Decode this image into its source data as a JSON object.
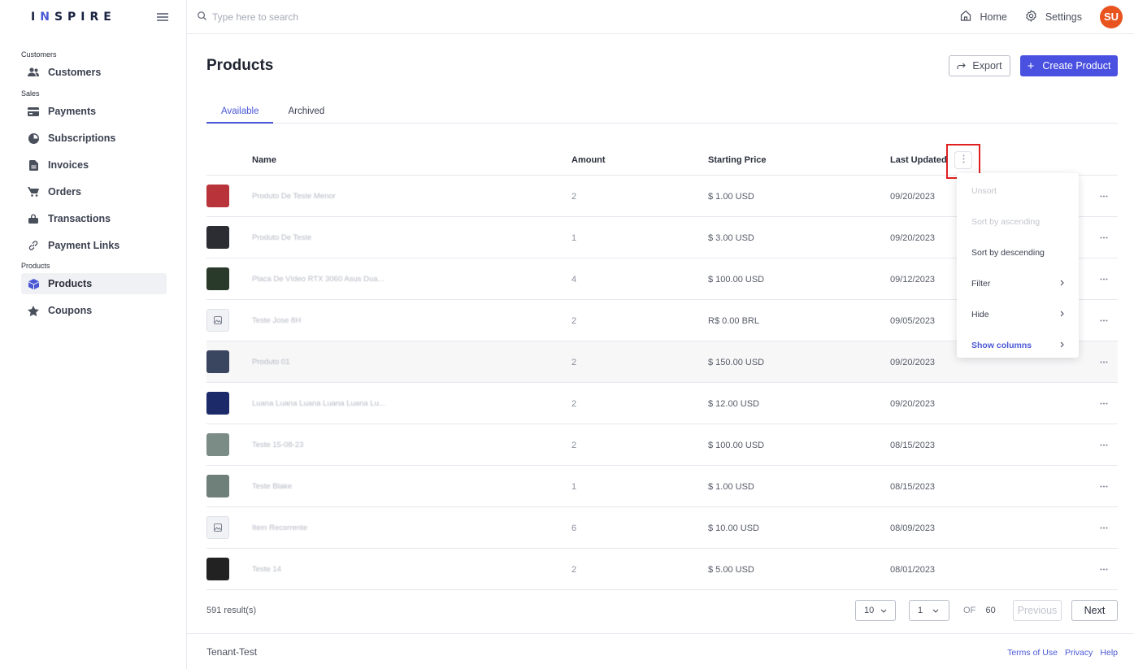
{
  "brand": {
    "logo": "INSPIRE"
  },
  "search": {
    "placeholder": "Type here to search"
  },
  "topbar": {
    "home_label": "Home",
    "settings_label": "Settings",
    "avatar_initials": "SU"
  },
  "sidebar": {
    "sections": [
      {
        "label": "Customers",
        "items": [
          {
            "label": "Customers",
            "icon": "users-icon"
          }
        ]
      },
      {
        "label": "Sales",
        "items": [
          {
            "label": "Payments",
            "icon": "credit-card-icon"
          },
          {
            "label": "Subscriptions",
            "icon": "pie-chart-icon"
          },
          {
            "label": "Invoices",
            "icon": "document-icon"
          },
          {
            "label": "Orders",
            "icon": "cart-icon"
          },
          {
            "label": "Transactions",
            "icon": "lock-icon"
          },
          {
            "label": "Payment Links",
            "icon": "link-icon"
          }
        ]
      },
      {
        "label": "Products",
        "items": [
          {
            "label": "Products",
            "icon": "cube-icon",
            "active": true
          },
          {
            "label": "Coupons",
            "icon": "star-icon"
          }
        ]
      }
    ]
  },
  "page": {
    "title": "Products",
    "export_label": "Export",
    "create_label": "Create Product"
  },
  "tabs": [
    {
      "label": "Available",
      "active": true
    },
    {
      "label": "Archived",
      "active": false
    }
  ],
  "table": {
    "columns": [
      "Name",
      "Amount",
      "Starting Price",
      "Last Updated"
    ],
    "rows": [
      {
        "name": "Produto De Teste Menor",
        "amount": "2",
        "price": "$ 1.00 USD",
        "updated": "09/20/2023",
        "thumb": "#b8343a"
      },
      {
        "name": "Produto De Teste",
        "amount": "1",
        "price": "$ 3.00 USD",
        "updated": "09/20/2023",
        "thumb": "#2b2d33"
      },
      {
        "name": "Placa De Vídeo RTX 3060 Asus Dua...",
        "amount": "4",
        "price": "$ 100.00 USD",
        "updated": "09/12/2023",
        "thumb": "#2a3a2a"
      },
      {
        "name": "Teste Jose 8H",
        "amount": "2",
        "price": "R$ 0.00 BRL",
        "updated": "09/05/2023",
        "thumb": "placeholder"
      },
      {
        "name": "Produto 01",
        "amount": "2",
        "price": "$ 150.00 USD",
        "updated": "09/20/2023",
        "thumb": "#3a4660",
        "hovered": true
      },
      {
        "name": "Luana Luana Luana Luana Luana Lu...",
        "amount": "2",
        "price": "$ 12.00 USD",
        "updated": "09/20/2023",
        "thumb": "#1c2a6a"
      },
      {
        "name": "Teste 15-08-23",
        "amount": "2",
        "price": "$ 100.00 USD",
        "updated": "08/15/2023",
        "thumb": "#7b8b86"
      },
      {
        "name": "Teste Blake",
        "amount": "1",
        "price": "$ 1.00 USD",
        "updated": "08/15/2023",
        "thumb": "#6f7f7a"
      },
      {
        "name": "Item Recorrente",
        "amount": "6",
        "price": "$ 10.00 USD",
        "updated": "08/09/2023",
        "thumb": "placeholder"
      },
      {
        "name": "Teste 14",
        "amount": "2",
        "price": "$ 5.00 USD",
        "updated": "08/01/2023",
        "thumb": "#222222"
      }
    ]
  },
  "column_menu": {
    "items": [
      {
        "label": "Unsort",
        "state": "disabled",
        "submenu": false
      },
      {
        "label": "Sort by ascending",
        "state": "disabled",
        "submenu": false
      },
      {
        "label": "Sort by descending",
        "state": "normal",
        "submenu": false
      },
      {
        "label": "Filter",
        "state": "normal",
        "submenu": true
      },
      {
        "label": "Hide",
        "state": "normal",
        "submenu": true
      },
      {
        "label": "Show columns",
        "state": "accent",
        "submenu": true
      }
    ]
  },
  "pagination": {
    "results": "591 result(s)",
    "page_size": "10",
    "page": "1",
    "of_label": "OF",
    "total_pages": "60",
    "previous_label": "Previous",
    "next_label": "Next"
  },
  "footer": {
    "tenant": "Tenant-Test",
    "links": [
      "Terms of Use",
      "Privacy",
      "Help"
    ]
  },
  "colors": {
    "accent": "#4a50e0",
    "avatar": "#e8531e",
    "highlight": "#e02020"
  }
}
